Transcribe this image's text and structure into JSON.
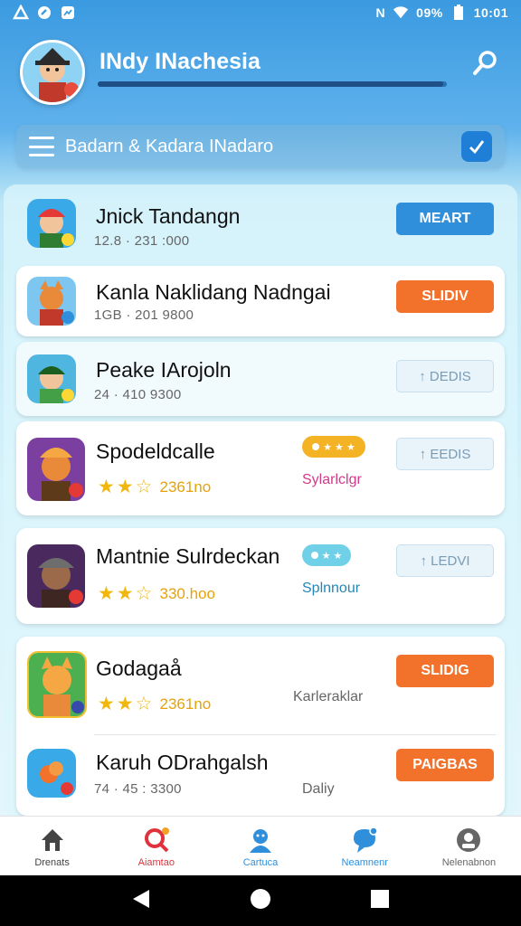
{
  "status_bar": {
    "signal_text": "N",
    "battery_text": "09%",
    "time": "10:01"
  },
  "header": {
    "title": "INdy INachesia",
    "progress": 0.99
  },
  "filter": {
    "label": "Badarn & Kadara INadaro"
  },
  "rows": [
    {
      "name": "Jnick Tandangn",
      "meta": "12.8 · 231 :000",
      "button": "MEART",
      "button_style": "blue"
    },
    {
      "name": "Kanla Naklidang Nadngai",
      "meta": "1GB · 201 9800",
      "button": "SLIDIV",
      "button_style": "orange"
    },
    {
      "name": "Peake IArojoln",
      "meta": "24 · 410 9300",
      "button": "↑ DEDIS",
      "button_style": "ghost"
    },
    {
      "name": "Spodeldcalle",
      "rating": "2361no",
      "tag": "Sylarlclgr",
      "button": "↑ EEDIS",
      "button_style": "ghost"
    },
    {
      "name": "Mantnie Sulrdeckan",
      "rating": "330.hoo",
      "tag": "Splnnour",
      "button": "↑ LEDVI",
      "button_style": "ghost"
    },
    {
      "name": "Godagaå",
      "rating": "2361no",
      "tag": "Karleraklar",
      "button": "SLIDIG",
      "button_style": "orange"
    },
    {
      "name": "Karuh ODrahgalsh",
      "meta": "74 · 45 : 3300",
      "tag": "Daliy",
      "button": "PAIGBAS",
      "button_style": "orange"
    }
  ],
  "bottom_nav": [
    {
      "label": "Drenats",
      "icon": "home-icon",
      "color": "#444444"
    },
    {
      "label": "Aiamtao",
      "icon": "search-icon",
      "color": "#e0323c"
    },
    {
      "label": "Cartuca",
      "icon": "profile-icon",
      "color": "#2f8fdb"
    },
    {
      "label": "Neamnenr",
      "icon": "chat-icon",
      "color": "#2f8fdb"
    },
    {
      "label": "Nelenabnon",
      "icon": "settings-icon",
      "color": "#666666"
    }
  ],
  "colors": {
    "accent": "#2f8fdb",
    "orange": "#f2722b",
    "header": "#3b9ae0"
  }
}
